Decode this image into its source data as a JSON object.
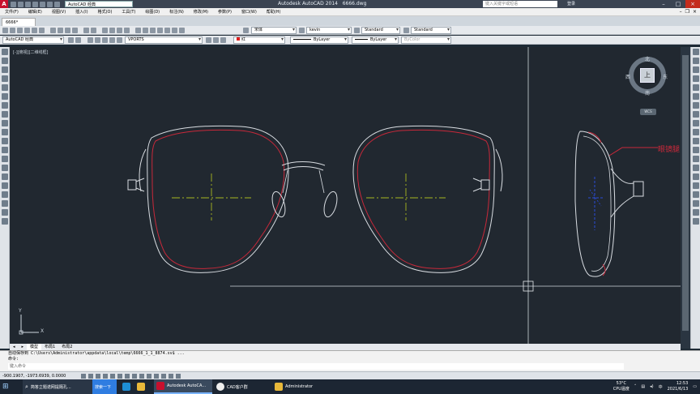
{
  "window": {
    "app_title": "Autodesk AutoCAD 2014",
    "file_title": "6666.dwg",
    "workspace": "AutoCAD 经典",
    "search_placeholder": "键入关键字或短语",
    "sign_in": "登录"
  },
  "menubar": {
    "items": [
      "文件(F)",
      "编辑(E)",
      "视图(V)",
      "插入(I)",
      "格式(O)",
      "工具(T)",
      "绘图(D)",
      "标注(N)",
      "修改(M)",
      "参数(P)",
      "窗口(W)",
      "帮助(H)"
    ]
  },
  "file_tab": {
    "label": "6666*"
  },
  "toolbar_styles": {
    "text_font": "宋体",
    "text_style": "kevin",
    "dim_style": "Standard",
    "table_style": "Standard"
  },
  "toolbar_layers": {
    "workspace": "AutoCAD 经典",
    "layer": "VPORTS",
    "color": "红",
    "linetype": "ByLayer",
    "lineweight": "ByLayer",
    "plotstyle": "ByColor"
  },
  "viewport": {
    "label": "[-][俯视][二维线框]",
    "annotation": "眼镜腿",
    "ucs_y": "Y",
    "ucs_x": "X"
  },
  "viewcube": {
    "north": "北",
    "south": "南",
    "east": "东",
    "west": "西",
    "face": "上",
    "wcs": "WCS"
  },
  "layout_tabs": [
    "模型",
    "布局1",
    "布局2"
  ],
  "command": {
    "history": [
      "自动保存到 C:\\Users\\Administrator\\appdata\\local\\temp\\6666_1_1_8874.sv$ ...",
      "命令:"
    ],
    "placeholder": "键入命令"
  },
  "status": {
    "coords": "-900.1907, -1973.6939, 0.0000"
  },
  "taskbar": {
    "search_text": "简答立题诺网提隔孔...",
    "search_button": "搜索一下",
    "items": [
      "Autodesk AutoCA...",
      "CAD客户群",
      "Administrator"
    ],
    "weather_temp": "53°C",
    "weather_label": "CPU温度",
    "time": "12:53",
    "date": "2021/6/13"
  },
  "colors": {
    "canvas_bg": "#212830",
    "frame_stroke": "#d9dde2",
    "lens_stroke": "#c8283a",
    "centerline": "#a8b820",
    "hinge_blue": "#2a4bd8"
  }
}
